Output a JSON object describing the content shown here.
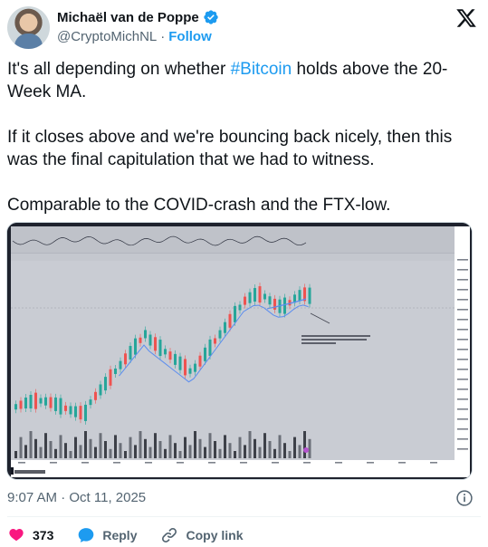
{
  "author": {
    "name": "Michaël van de Poppe",
    "handle": "@CryptoMichNL",
    "separator": "·",
    "follow_label": "Follow"
  },
  "tweet": {
    "line1_before": "It's all depending on whether ",
    "hashtag": "#Bitcoin",
    "line1_after": " holds above the 20-Week MA.",
    "paragraph2": "If it closes above and we're bouncing back nicely, then this was the final capitulation that we had to witness.",
    "paragraph3": "Comparable to the COVID-crash and the FTX-low."
  },
  "timestamp": "9:07 AM · Oct 11, 2025",
  "actions": {
    "like_count": "373",
    "reply_label": "Reply",
    "copy_link_label": "Copy link"
  },
  "colors": {
    "accent": "#1d9bf0",
    "like": "#f91880",
    "up_candle": "#26a69a",
    "down_candle": "#ef5350",
    "ma_line": "#5b8def"
  }
}
